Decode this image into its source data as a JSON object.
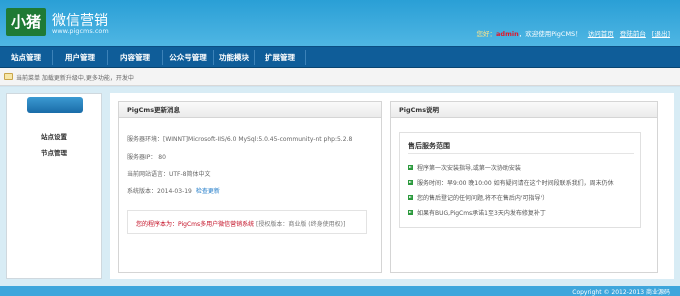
{
  "header": {
    "logo_text": "小猪",
    "brand_name": "微信营销",
    "brand_url": "www.pigcms.com",
    "welcome_prefix": "您好：",
    "username": "admin",
    "welcome_suffix": "，欢迎使用PigCMS！",
    "link_home": "访问首页",
    "link_backend": "登陆前台",
    "link_logout": "[退出]"
  },
  "nav": {
    "items": [
      "站点管理",
      "用户管理",
      "内容管理",
      "公众号管理",
      "功能模块",
      "扩展管理"
    ]
  },
  "tip": {
    "text": "当前菜单 加载更新升级中,更多功能，开发中"
  },
  "sidebar": {
    "items": [
      "站点设置",
      "节点管理"
    ]
  },
  "update_panel": {
    "title": "PigCms更新消息",
    "server_env": "服务器环境：[WINNT]Microsoft-IIS/6.0 MySql:5.0.45-community-nt php:5.2.8",
    "server_ip": "服务器IP： 80",
    "site_lang": "当前网站语言：UTF-8简体中文",
    "version_text": "系统版本：2014-03-19",
    "check_update": "检查更新",
    "notice_red": "您的程序本为：PigCms多用户微信营销系统",
    "notice_gray": "[授权版本：商业版 (终身使用权)]"
  },
  "service_panel": {
    "title": "PigCms说明",
    "box_title": "售后服务范围",
    "items": [
      "程序第一次安装指导,或第一次协助安装",
      "服务时间：早9:00 晚10:00 如有疑问请在这个时间段联系我们，周末仍休",
      "您的售后登记的任何问题,将不在售后内'可指导'）",
      "如果有BUG,PigCms承诺1至3天内发布修复补丁"
    ]
  },
  "footer": {
    "text": "Copyright © 2012-2013 商业源码"
  },
  "colors": {
    "header_blue": "#2a9fd6",
    "nav_blue": "#0f5d99",
    "logo_green": "#1f7a35",
    "notice_red": "#c30d23",
    "link_blue": "#1e7ac8"
  }
}
